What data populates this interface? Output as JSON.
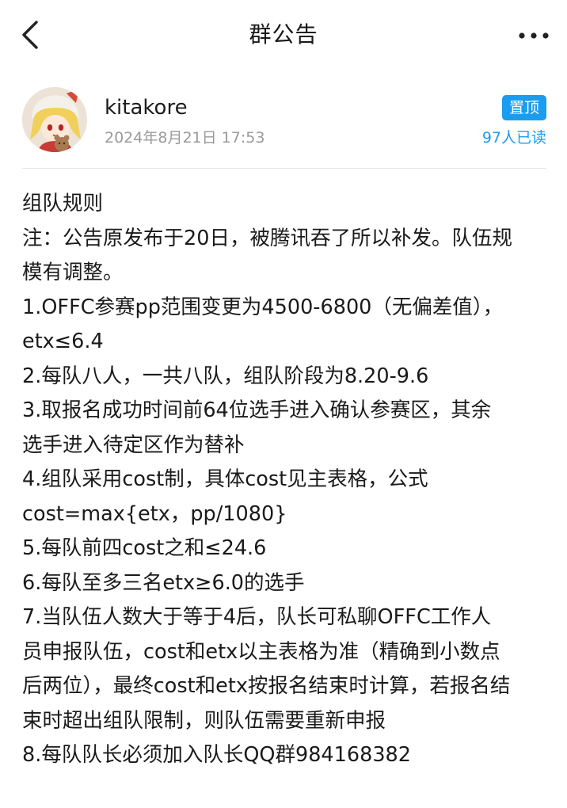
{
  "header": {
    "title": "群公告",
    "back_icon": "chevron-left-icon",
    "more_icon": "more-horizontal-icon"
  },
  "author": {
    "name": "kitakore",
    "timestamp": "2024年8月21日 17:53",
    "pinned_label": "置顶",
    "read_count": "97人已读"
  },
  "colors": {
    "accent": "#1a9cf0",
    "text": "#1a1a1a",
    "muted": "#9a9a9a",
    "divider": "#e8e8e8"
  },
  "announcement": {
    "lines": [
      "组队规则",
      "注：公告原发布于20日，被腾讯吞了所以补发。队伍规",
      "模有调整。",
      "1.OFFC参赛pp范围变更为4500-6800（无偏差值），",
      "etx≤6.4",
      "2.每队八人，一共八队，组队阶段为8.20-9.6",
      "3.取报名成功时间前64位选手进入确认参赛区，其余",
      "选手进入待定区作为替补",
      "4.组队采用cost制，具体cost见主表格，公式",
      "cost=max{etx，pp/1080}",
      "5.每队前四cost之和≤24.6",
      "6.每队至多三名etx≥6.0的选手",
      "7.当队伍人数大于等于4后，队长可私聊OFFC工作人",
      "员申报队伍，cost和etx以主表格为准（精确到小数点",
      "后两位），最终cost和etx按报名结束时计算，若报名结",
      "束时超出组队限制，则队伍需要重新申报",
      "8.每队队长必须加入队长QQ群984168382"
    ]
  }
}
